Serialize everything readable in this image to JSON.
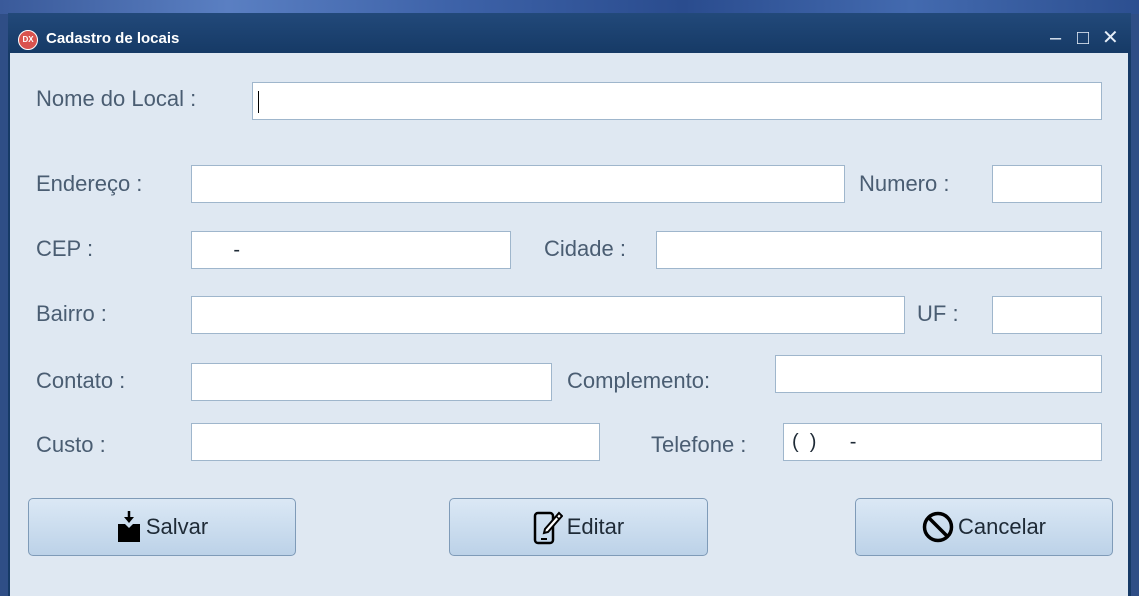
{
  "window": {
    "title": "Cadastro de locais",
    "icon_text": "DX",
    "controls": {
      "minimize": "–",
      "maximize": "□",
      "close": "✕"
    }
  },
  "form": {
    "nome_label": "Nome do Local :",
    "nome_value": "",
    "endereco_label": "Endereço :",
    "endereco_value": "",
    "numero_label": "Numero :",
    "numero_value": "",
    "cep_label": "CEP :",
    "cep_value": "      -",
    "cidade_label": "Cidade :",
    "cidade_value": "",
    "bairro_label": "Bairro :",
    "bairro_value": "",
    "uf_label": "UF :",
    "uf_value": "",
    "contato_label": "Contato :",
    "contato_value": "",
    "complemento_label": "Complemento:",
    "complemento_value": "",
    "custo_label": "Custo :",
    "custo_value": "",
    "telefone_label": "Telefone :",
    "telefone_value": "(  )      -"
  },
  "buttons": {
    "salvar": "Salvar",
    "editar": "Editar",
    "cancelar": "Cancelar"
  },
  "icons": {
    "save": "download-box-icon",
    "edit": "pencil-phone-icon",
    "cancel": "prohibited-icon"
  },
  "colors": {
    "title_bar": "#163a66",
    "client_bg": "#dfe8f2",
    "label_text": "#4a5d72",
    "button_bg": "#c8dbee"
  }
}
